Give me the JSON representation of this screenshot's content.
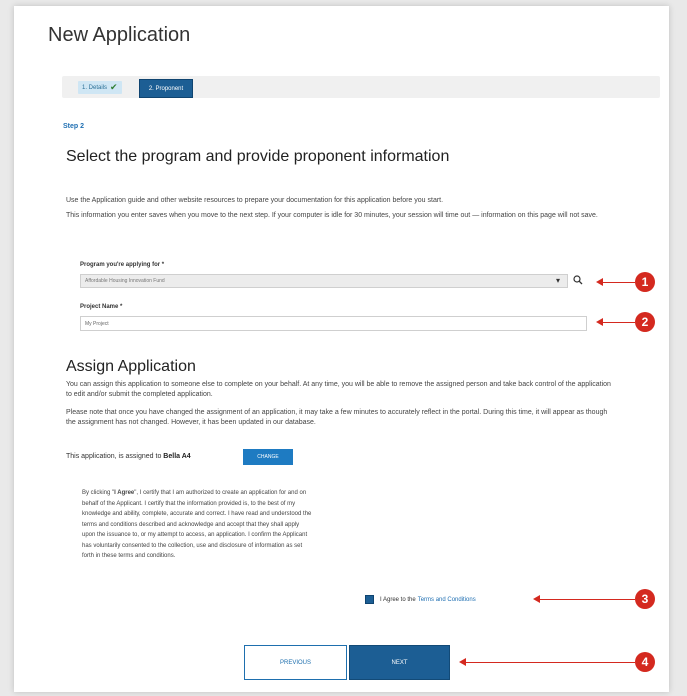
{
  "app_title": "New Application",
  "stepper": {
    "step1_label": "1. Details",
    "step1_check": "✔",
    "step2_label": "2. Proponent"
  },
  "step_label": "Step 2",
  "section_title": "Select the program and provide proponent information",
  "intro": {
    "line1": "Use the Application guide and other website resources to prepare your documentation for this application before you start.",
    "line2": "This information you enter saves when you move to the next step. If your computer is idle for 30 minutes, your session will time out — information on this page will not save."
  },
  "program_field": {
    "label": "Program you're applying for *",
    "value": "Affordable Housing Innovation Fund",
    "chevron": "▾",
    "icon": "search-icon"
  },
  "project_field": {
    "label": "Project Name *",
    "value": "My Project"
  },
  "assign": {
    "title": "Assign Application",
    "para1": "You can assign this application to someone else to complete on your behalf. At any time, you will be able to remove the assigned person and take back control of the application to edit and/or submit the completed application.",
    "para2": "Please note that once you have changed the assignment of an application, it may take a few minutes to accurately reflect in the portal. During this time, it will appear as though the assignment has not changed. However, it has been updated in our database.",
    "assigned_prefix": "This application, is assigned to",
    "assignee": "Bella A4",
    "change_label": "CHANGE"
  },
  "terms": {
    "bold_lead": "I Agree",
    "prefix": "By clicking \"",
    "body": "\", I certify that I am authorized to create an application for and on behalf of the Applicant. I certify that the information provided is, to the best of my knowledge and ability, complete, accurate and correct. I have read and understood the terms and conditions described and acknowledge and accept that they shall apply upon the issuance to, or my attempt to access, an application. I confirm the Applicant has voluntarily consented to the collection, use and disclosure of information as set forth in these terms and conditions.",
    "agree_text": "I Agree to the",
    "agree_link": "Terms and Conditions"
  },
  "buttons": {
    "previous": "PREVIOUS",
    "next": "NEXT"
  },
  "callouts": [
    "1",
    "2",
    "3",
    "4"
  ],
  "colors": {
    "primary": "#1c5e94",
    "callout": "#d4291f",
    "link": "#1f6fb2"
  }
}
